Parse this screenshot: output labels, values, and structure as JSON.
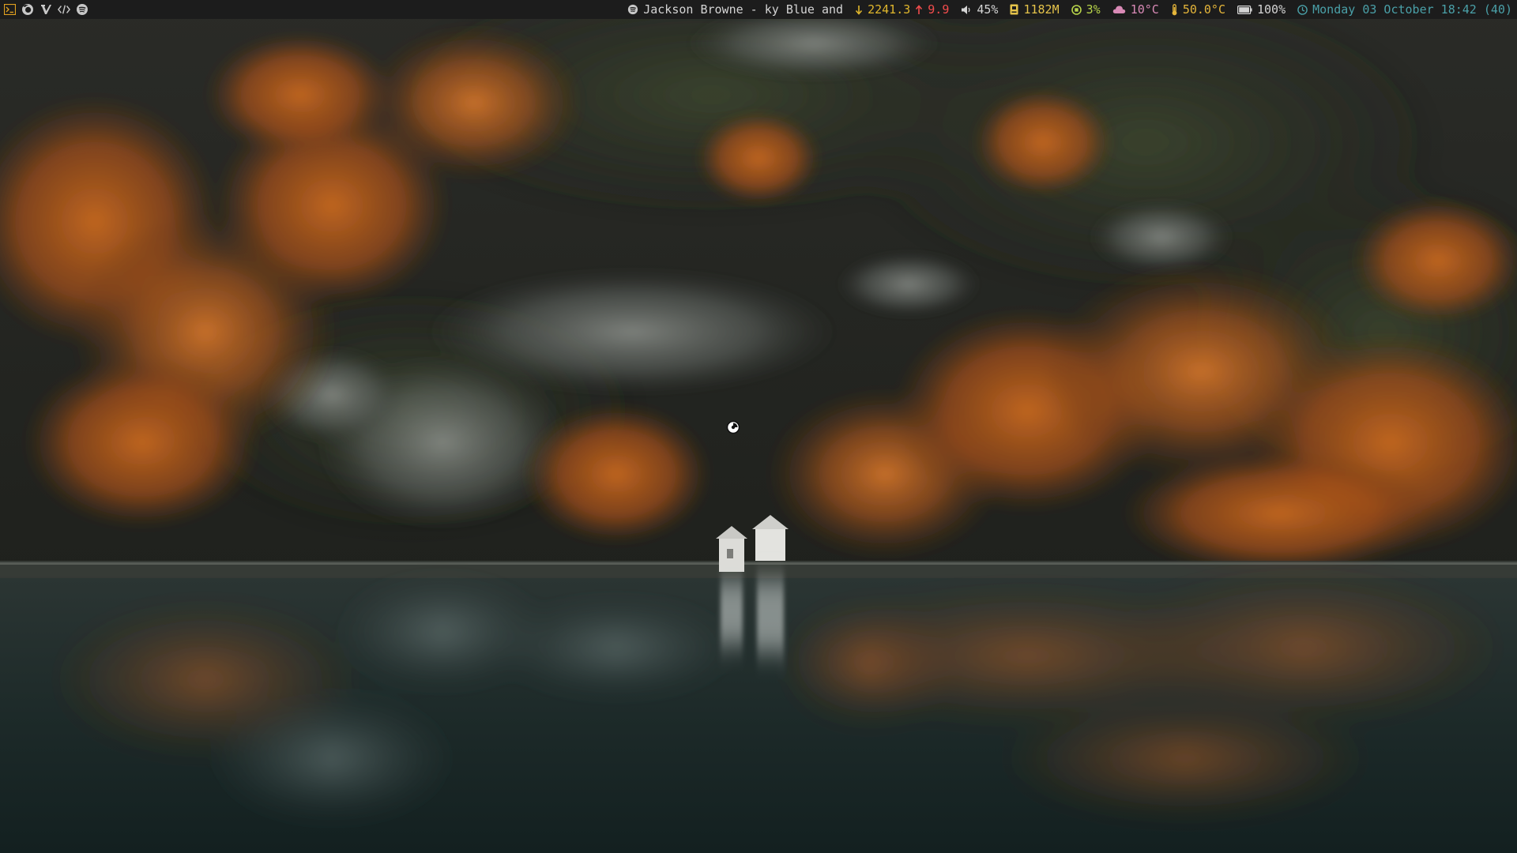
{
  "workspaces": [
    {
      "icon": "terminal-icon",
      "color": "#e0a020"
    },
    {
      "icon": "firefox-icon",
      "color": "#c8c8c8"
    },
    {
      "icon": "vim-icon",
      "color": "#c8c8c8"
    },
    {
      "icon": "code-icon",
      "color": "#c8c8c8"
    },
    {
      "icon": "spotify-icon",
      "color": "#c8c8c8"
    }
  ],
  "statusbar": {
    "media": {
      "icon": "spotify-icon",
      "text": "Jackson Browne - ky Blue and",
      "color": "#d4d4d4"
    },
    "network": {
      "down_icon": "arrow-down-icon",
      "down": "2241.3",
      "down_color": "#e0b62c",
      "up_icon": "arrow-up-icon",
      "up": "9.9",
      "up_color": "#f14c4c"
    },
    "volume": {
      "icon": "speaker-icon",
      "text": "45%",
      "color": "#d4d4d4"
    },
    "memory": {
      "icon": "memory-icon",
      "text": "1182M",
      "color": "#e5c34a"
    },
    "cpu": {
      "icon": "cpu-icon",
      "text": "3%",
      "color": "#b7d34a"
    },
    "weather": {
      "icon": "cloud-icon",
      "text": "10°C",
      "color": "#d98ab6"
    },
    "temperature": {
      "icon": "thermometer-icon",
      "text": "50.0°C",
      "color": "#e5b53a"
    },
    "battery": {
      "icon": "battery-icon",
      "text": "100%",
      "color": "#d4d4d4"
    },
    "clock": {
      "icon": "clock-icon",
      "text": "Monday 03 October 18:42 (40)",
      "color": "#4aa0a8"
    }
  },
  "wallpaper": {
    "subject": "autumn-forest-lake-reflection"
  },
  "cursor": {
    "icon": "busy-cursor-icon"
  }
}
